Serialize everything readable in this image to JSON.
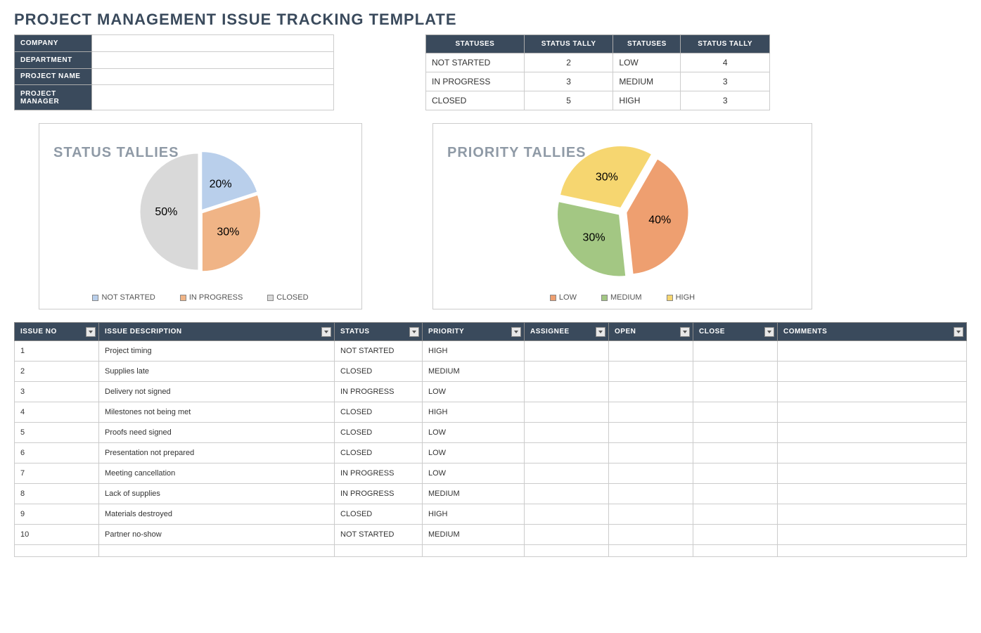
{
  "title": "PROJECT MANAGEMENT ISSUE TRACKING TEMPLATE",
  "info_labels": {
    "company": "COMPANY",
    "department": "DEPARTMENT",
    "project_name": "PROJECT NAME",
    "project_manager": "PROJECT MANAGER"
  },
  "info_values": {
    "company": "",
    "department": "",
    "project_name": "",
    "project_manager": ""
  },
  "tally_headers": {
    "statuses": "STATUSES",
    "status_tally": "STATUS TALLY"
  },
  "status_tally": [
    {
      "name": "NOT STARTED",
      "count": "2"
    },
    {
      "name": "IN PROGRESS",
      "count": "3"
    },
    {
      "name": "CLOSED",
      "count": "5"
    }
  ],
  "priority_tally": [
    {
      "name": "LOW",
      "count": "4"
    },
    {
      "name": "MEDIUM",
      "count": "3"
    },
    {
      "name": "HIGH",
      "count": "3"
    }
  ],
  "chart_data": [
    {
      "type": "pie",
      "title": "STATUS TALLIES",
      "categories": [
        "NOT STARTED",
        "IN PROGRESS",
        "CLOSED"
      ],
      "values": [
        20,
        30,
        50
      ],
      "labels": [
        "20%",
        "30%",
        "50%"
      ],
      "colors": [
        "#b9cfeb",
        "#f0b486",
        "#d9d9d9"
      ]
    },
    {
      "type": "pie",
      "title": "PRIORITY TALLIES",
      "categories": [
        "LOW",
        "MEDIUM",
        "HIGH"
      ],
      "values": [
        40,
        30,
        30
      ],
      "labels": [
        "40%",
        "30%",
        "30%"
      ],
      "colors": [
        "#ee9f70",
        "#a3c783",
        "#f6d670"
      ]
    }
  ],
  "issue_headers": {
    "no": "ISSUE NO",
    "desc": "ISSUE DESCRIPTION",
    "status": "STATUS",
    "priority": "PRIORITY",
    "assignee": "ASSIGNEE",
    "open": "OPEN",
    "close": "CLOSE",
    "comments": "COMMENTS"
  },
  "issues": [
    {
      "no": "1",
      "desc": "Project timing",
      "status": "NOT STARTED",
      "priority": "HIGH",
      "assignee": "",
      "open": "",
      "close": "",
      "comments": ""
    },
    {
      "no": "2",
      "desc": "Supplies late",
      "status": "CLOSED",
      "priority": "MEDIUM",
      "assignee": "",
      "open": "",
      "close": "",
      "comments": ""
    },
    {
      "no": "3",
      "desc": "Delivery not signed",
      "status": "IN PROGRESS",
      "priority": "LOW",
      "assignee": "",
      "open": "",
      "close": "",
      "comments": ""
    },
    {
      "no": "4",
      "desc": "Milestones not being met",
      "status": "CLOSED",
      "priority": "HIGH",
      "assignee": "",
      "open": "",
      "close": "",
      "comments": ""
    },
    {
      "no": "5",
      "desc": "Proofs need signed",
      "status": "CLOSED",
      "priority": "LOW",
      "assignee": "",
      "open": "",
      "close": "",
      "comments": ""
    },
    {
      "no": "6",
      "desc": "Presentation not prepared",
      "status": "CLOSED",
      "priority": "LOW",
      "assignee": "",
      "open": "",
      "close": "",
      "comments": ""
    },
    {
      "no": "7",
      "desc": "Meeting cancellation",
      "status": "IN PROGRESS",
      "priority": "LOW",
      "assignee": "",
      "open": "",
      "close": "",
      "comments": ""
    },
    {
      "no": "8",
      "desc": "Lack of supplies",
      "status": "IN PROGRESS",
      "priority": "MEDIUM",
      "assignee": "",
      "open": "",
      "close": "",
      "comments": ""
    },
    {
      "no": "9",
      "desc": "Materials destroyed",
      "status": "CLOSED",
      "priority": "HIGH",
      "assignee": "",
      "open": "",
      "close": "",
      "comments": ""
    },
    {
      "no": "10",
      "desc": "Partner no-show",
      "status": "NOT STARTED",
      "priority": "MEDIUM",
      "assignee": "",
      "open": "",
      "close": "",
      "comments": ""
    },
    {
      "no": "",
      "desc": "",
      "status": "",
      "priority": "",
      "assignee": "",
      "open": "",
      "close": "",
      "comments": ""
    }
  ]
}
